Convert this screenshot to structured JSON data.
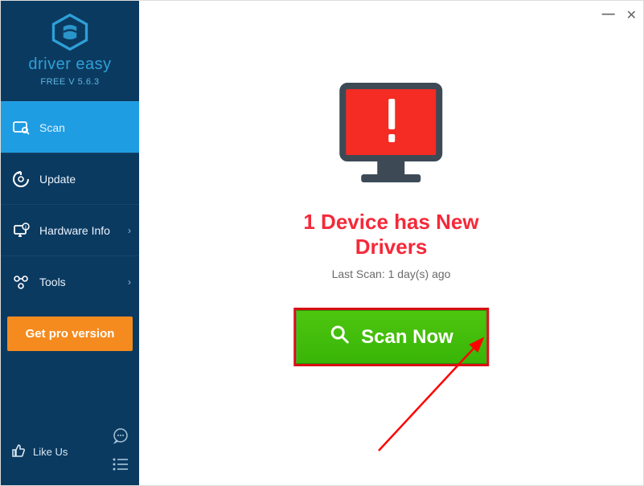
{
  "logo": {
    "text": "driver easy",
    "sub": "FREE V 5.6.3"
  },
  "nav": {
    "scan": "Scan",
    "update": "Update",
    "hardware": "Hardware Info",
    "tools": "Tools"
  },
  "getpro": "Get pro version",
  "likeus": "Like Us",
  "main": {
    "headline": "1 Device has New Drivers",
    "lastscan": "Last Scan: 1 day(s) ago",
    "scan_button": "Scan Now"
  }
}
